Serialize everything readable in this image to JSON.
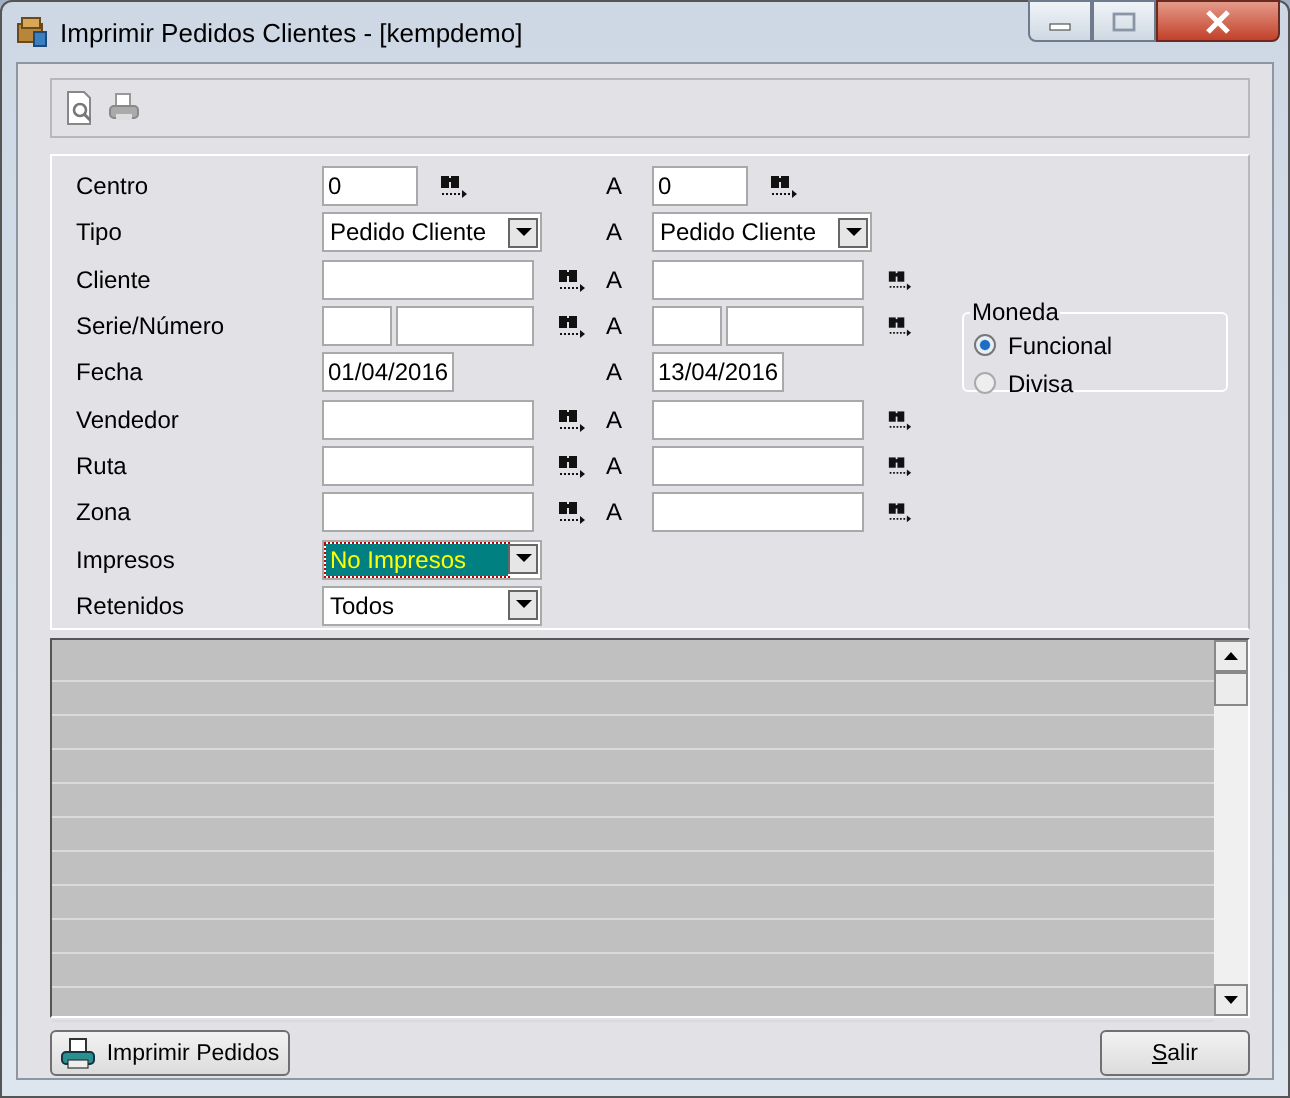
{
  "window": {
    "title": "Imprimir Pedidos Clientes - [kempdemo]"
  },
  "filters": [
    {
      "label": "Centro",
      "kind": "short",
      "lookup": true,
      "from_value": "0",
      "separator": "A",
      "to_value": "0"
    },
    {
      "label": "Tipo",
      "kind": "combo",
      "lookup": false,
      "from_value": "Pedido Cliente",
      "from_focused": false,
      "separator": "A",
      "to_value": "Pedido Cliente",
      "to_focused": false
    },
    {
      "label": "Cliente",
      "kind": "text",
      "lookup": true,
      "separator": "A"
    },
    {
      "label": "Serie/Número",
      "kind": "split",
      "lookup": true,
      "separator": "A"
    },
    {
      "label": "Fecha",
      "kind": "date",
      "lookup": false,
      "from_value": "01/04/2016",
      "separator": "A",
      "to_value": "13/04/2016"
    },
    {
      "label": "Vendedor",
      "kind": "text",
      "lookup": true,
      "separator": "A"
    },
    {
      "label": "Ruta",
      "kind": "text",
      "lookup": true,
      "separator": "A"
    },
    {
      "label": "Zona",
      "kind": "text",
      "lookup": true,
      "separator": "A"
    },
    {
      "label": "Impresos",
      "kind": "combo",
      "lookup": false,
      "from_value": "No Impresos",
      "from_focused": true
    },
    {
      "label": "Retenidos",
      "kind": "combo",
      "lookup": false,
      "from_value": "Todos",
      "from_focused": false
    }
  ],
  "currency": {
    "title": "Moneda",
    "options": [
      {
        "label": "Funcional",
        "selected": true
      },
      {
        "label": "Divisa",
        "selected": false
      }
    ]
  },
  "buttons": [
    {
      "label": "Imprimir Pedidos",
      "kind": "print",
      "mnemonic": false
    },
    {
      "label": "Salir",
      "kind": "plain",
      "mnemonic": true
    }
  ]
}
